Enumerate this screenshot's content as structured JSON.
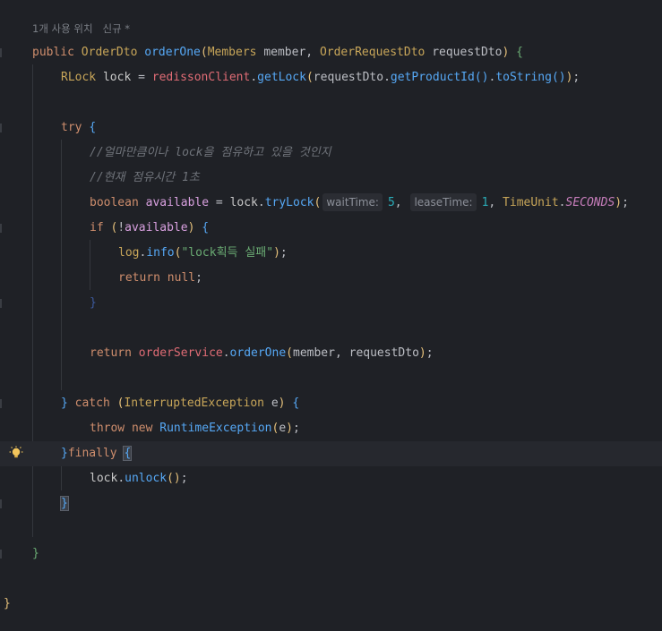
{
  "editor": {
    "usage_hint": "1개 사용 위치   신규 *",
    "colors": {
      "background": "#1f2126",
      "current_line": "#26282e",
      "keyword": "#cf8e6d",
      "method": "#56a8f5",
      "string": "#6aab73",
      "number": "#2aacb8",
      "comment": "#6f737a"
    },
    "code": {
      "l1": {
        "kw": "public",
        "ret_type": "OrderDto",
        "name": "orderOne",
        "p1_type": "Members",
        "p1_name": "member",
        "p2_type": "OrderRequestDto",
        "p2_name": "requestDto"
      },
      "l2": {
        "type": "RLock",
        "var": "lock",
        "field": "redissonClient",
        "m1": "getLock",
        "arg": "requestDto",
        "m2": "getProductId",
        "m3": "toString"
      },
      "l3": {
        "kw": "try"
      },
      "l4": {
        "comment": "//얼마만큼이나 lock을 점유하고 있을 것인지"
      },
      "l5": {
        "comment": "//현재 점유시간 1초"
      },
      "l6": {
        "type": "boolean",
        "var": "available",
        "obj": "lock",
        "method": "tryLock",
        "hint1": "waitTime:",
        "val1": "5",
        "hint2": "leaseTime:",
        "val2": "1",
        "unit_type": "TimeUnit",
        "unit_const": "SECONDS"
      },
      "l7": {
        "kw": "if",
        "var": "available"
      },
      "l8": {
        "obj": "log",
        "method": "info",
        "str": "\"lock획득 실패\""
      },
      "l9": {
        "kw": "return",
        "val": "null"
      },
      "l10": {
        "kw": "return",
        "field": "orderService",
        "method": "orderOne",
        "a1": "member",
        "a2": "requestDto"
      },
      "l11": {
        "kw": "catch",
        "type": "InterruptedException",
        "var": "e"
      },
      "l12": {
        "kw1": "throw",
        "kw2": "new",
        "type": "RuntimeException",
        "arg": "e"
      },
      "l13": {
        "kw": "finally"
      },
      "l14": {
        "obj": "lock",
        "method": "unlock"
      }
    }
  }
}
